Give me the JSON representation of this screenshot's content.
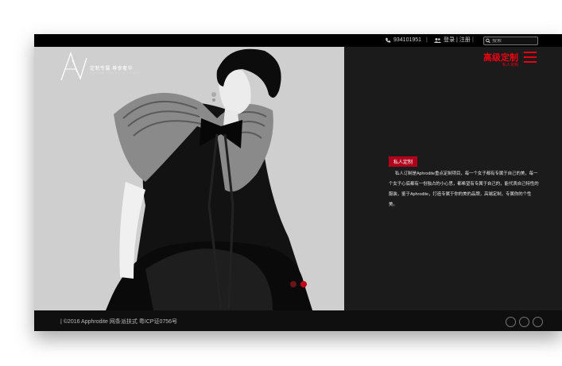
{
  "topbar": {
    "phone": "934101951",
    "login": "登录 | 注册",
    "separator": "|",
    "search_placeholder": "搜索"
  },
  "logo": {
    "tagline": "定制专属  尊享奢华",
    "subtitle": "CUSTOM EXCLUSIVE LUXURY"
  },
  "menu": {
    "title": "高级定制",
    "subtitle": "私人定制"
  },
  "content": {
    "badge": "私人定制",
    "description": "私人订制是Aphrodite重点定制项目，每一个女子都有专属于自己的美，每一个女子心底都有一份独占的小心思，都希望有专属于自己的，能代表自己特性的服装，鉴于Aphrodite，打造专属于你的美的品牌，高端定制，专属你的个性美。"
  },
  "slider": {
    "total": 2,
    "active": 2
  },
  "footer": {
    "copyright": "| ©2016 Apphrodite  网条派扶式   粤ICP证0756号"
  },
  "colors": {
    "accent": "#e60012",
    "badge": "#b0001c"
  }
}
